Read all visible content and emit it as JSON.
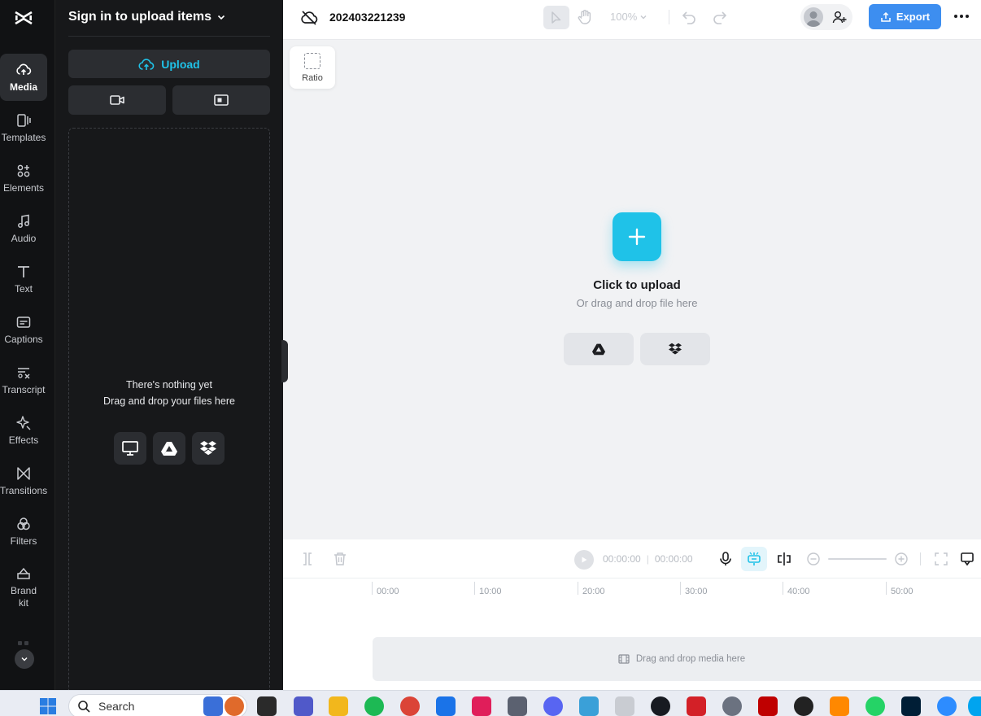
{
  "rail": {
    "items": [
      {
        "label": "Media",
        "icon": "cloud-upload-icon",
        "active": true
      },
      {
        "label": "Templates",
        "icon": "templates-icon"
      },
      {
        "label": "Elements",
        "icon": "elements-icon"
      },
      {
        "label": "Audio",
        "icon": "music-note-icon"
      },
      {
        "label": "Text",
        "icon": "text-icon"
      },
      {
        "label": "Captions",
        "icon": "captions-icon"
      },
      {
        "label": "Transcript",
        "icon": "transcript-icon"
      },
      {
        "label": "Effects",
        "icon": "sparkle-icon"
      },
      {
        "label": "Transitions",
        "icon": "transitions-icon"
      },
      {
        "label": "Filters",
        "icon": "filters-icon"
      },
      {
        "label": "Brand\nkit",
        "icon": "brand-kit-icon"
      }
    ]
  },
  "panel": {
    "title": "Sign in to upload items",
    "upload_label": "Upload",
    "empty_line1": "There's nothing yet",
    "empty_line2": "Drag and drop your files here"
  },
  "topbar": {
    "project_name": "202403221239",
    "zoom": "100%",
    "export_label": "Export"
  },
  "canvas": {
    "ratio_label": "Ratio",
    "cta_title": "Click to upload",
    "cta_sub": "Or drag and drop file here"
  },
  "timeline": {
    "current_time": "00:00:00",
    "total_time": "00:00:00",
    "ticks": [
      "00:00",
      "10:00",
      "20:00",
      "30:00",
      "40:00",
      "50:00"
    ],
    "drop_label": "Drag and drop media here"
  },
  "taskbar": {
    "search_placeholder": "Search"
  },
  "colors": {
    "accent": "#1fc2e8",
    "export": "#3d8ef0",
    "rail_bg": "#111214",
    "panel_bg": "#17181a"
  }
}
